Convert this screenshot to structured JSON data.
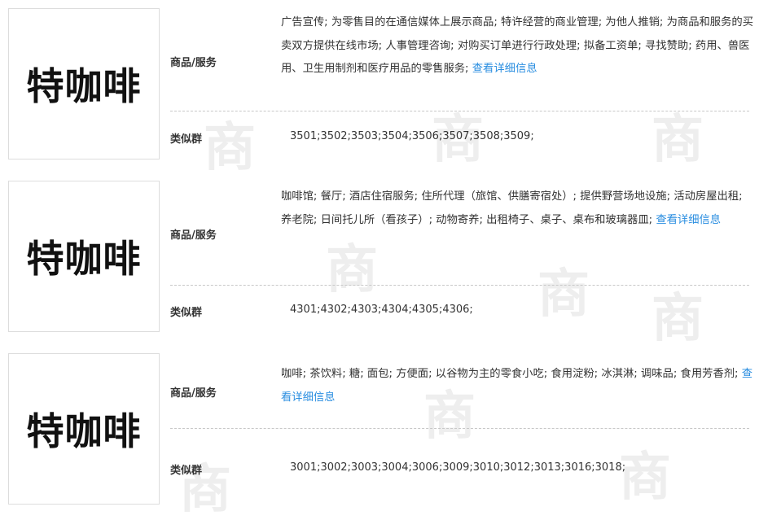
{
  "watermark_char": "商",
  "records": [
    {
      "logo_text": "特咖啡",
      "goods_label": "商品/服务",
      "goods_text": "广告宣传; 为零售目的在通信媒体上展示商品; 特许经营的商业管理; 为他人推销; 为商品和服务的买卖双方提供在线市场; 人事管理咨询; 对购买订单进行行政处理; 拟备工资单; 寻找赞助; 药用、兽医用、卫生用制剂和医疗用品的零售服务; ",
      "detail_link": "查看详细信息",
      "group_label": "类似群",
      "group_codes": "3501;3502;3503;3504;3506;3507;3508;3509;"
    },
    {
      "logo_text": "特咖啡",
      "goods_label": "商品/服务",
      "goods_text": "咖啡馆; 餐厅; 酒店住宿服务; 住所代理（旅馆、供膳寄宿处）; 提供野营场地设施; 活动房屋出租; 养老院; 日间托儿所（看孩子）; 动物寄养; 出租椅子、桌子、桌布和玻璃器皿; ",
      "detail_link": "查看详细信息",
      "group_label": "类似群",
      "group_codes": "4301;4302;4303;4304;4305;4306;"
    },
    {
      "logo_text": "特咖啡",
      "goods_label": "商品/服务",
      "goods_text": "咖啡; 茶饮料; 糖; 面包; 方便面; 以谷物为主的零食小吃; 食用淀粉; 冰淇淋; 调味品; 食用芳香剂; ",
      "detail_link": "查看详细信息",
      "group_label": "类似群",
      "group_codes": "3001;3002;3003;3004;3006;3009;3010;3012;3013;3016;3018;"
    }
  ]
}
